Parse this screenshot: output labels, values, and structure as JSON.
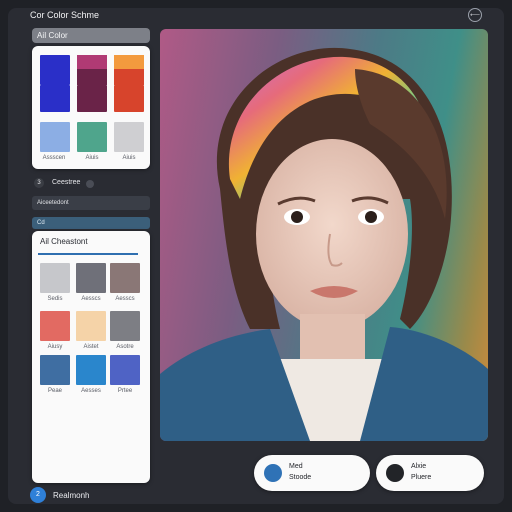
{
  "header": {
    "app_title": "Cor Color Schme",
    "close_icon": "exit-icon",
    "close_glyph": "⟵"
  },
  "left_panel": {
    "ai_color_label": "AiI Color",
    "palette_card": {
      "swatches": [
        {
          "name": "blue",
          "color": "#2a2fc8"
        },
        {
          "name": "magenta-plum",
          "top": "#b03a74",
          "bottom": "#6a2348"
        },
        {
          "name": "orange-red",
          "top": "#f39a3e",
          "bottom": "#d7442c"
        },
        {
          "name": "light-blue",
          "color": "#8caee4"
        },
        {
          "name": "teal-green",
          "color": "#4fa58c"
        },
        {
          "name": "light-gray",
          "color": "#cfcfd2"
        }
      ],
      "labels": [
        "Assscen",
        "Aiuis",
        "Aiuis"
      ]
    },
    "row": {
      "badge": "3",
      "label": "Ceestree"
    },
    "bar_dark_label": "Aiceetedont",
    "bar_teal_label": "Cd",
    "card2": {
      "title": "Ail Cheastont",
      "swatches": [
        {
          "color": "#c6c7cb",
          "label": "Sedis"
        },
        {
          "color": "#6f7079",
          "label": "Aesscs"
        },
        {
          "color": "#8a7776",
          "label": "Aesscs"
        },
        {
          "color": "#e26a62",
          "label": "Aiusy"
        },
        {
          "color": "#f5d3a8",
          "label": "Aistet"
        },
        {
          "color": "#7d7e84",
          "label": "Asotre"
        },
        {
          "color": "#3f6ea2",
          "label": "Peae"
        },
        {
          "color": "#2a86cc",
          "label": "Aesses"
        },
        {
          "color": "#4f63c5",
          "label": "Prtee"
        }
      ]
    }
  },
  "bottom": {
    "step_badge": "2",
    "step_label": "Realmonh"
  },
  "chips": [
    {
      "dot_color": "#2f72b6",
      "line1": "Med",
      "line2": "Stoode"
    },
    {
      "dot_color": "#222428",
      "line1": "Alxie",
      "line2": "Pluere"
    }
  ]
}
